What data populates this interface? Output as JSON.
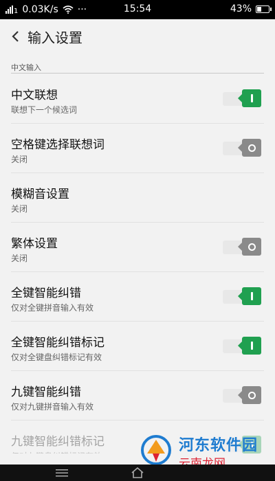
{
  "status_bar": {
    "signal": "1",
    "speed": "0.03K/s",
    "more": "···",
    "time": "15:54",
    "battery": "43%",
    "battery_level": 0.43
  },
  "header": {
    "title": "输入设置"
  },
  "section": {
    "label": "中文输入"
  },
  "items": [
    {
      "title": "中文联想",
      "subtitle": "联想下一个候选词",
      "state": "on"
    },
    {
      "title": "空格键选择联想词",
      "subtitle": "关闭",
      "state": "off"
    },
    {
      "title": "模糊音设置",
      "subtitle": "关闭",
      "state": "none"
    },
    {
      "title": "繁体设置",
      "subtitle": "关闭",
      "state": "off"
    },
    {
      "title": "全键智能纠错",
      "subtitle": "仅对全键拼音输入有效",
      "state": "on"
    },
    {
      "title": "全键智能纠错标记",
      "subtitle": "仅对全键盘纠错标记有效",
      "state": "on"
    },
    {
      "title": "九键智能纠错",
      "subtitle": "仅对九键拼音输入有效",
      "state": "off"
    },
    {
      "title": "九键智能纠错标记",
      "subtitle": "仅对九键盘纠错标记有效",
      "state": "on"
    }
  ],
  "watermark": {
    "line1": "河东软件园",
    "line2": "云南龙网"
  },
  "colors": {
    "toggle_on": "#20a050",
    "toggle_off": "#8a8a8a",
    "status_bar": "#000000",
    "background": "#f2f2f2"
  }
}
